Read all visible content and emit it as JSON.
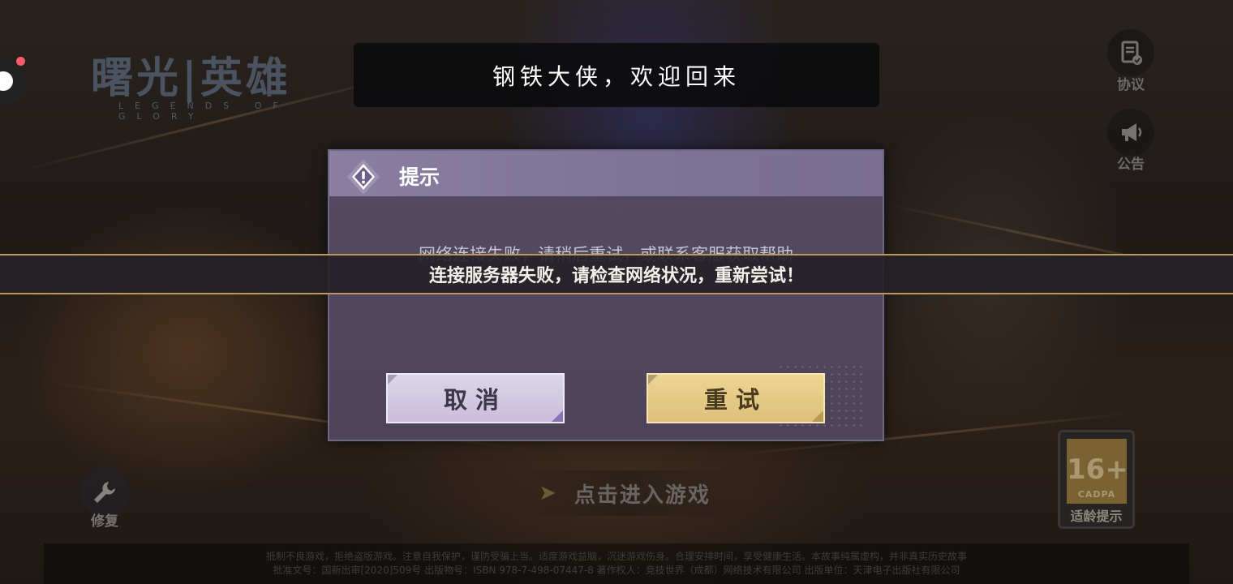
{
  "logo": {
    "title": "曙光|英雄",
    "subtitle": "LEGENDS OF GLORY"
  },
  "welcome": {
    "text": "钢铁大侠，欢迎回来"
  },
  "side": {
    "agreement_label": "协议",
    "notice_label": "公告"
  },
  "repair": {
    "label": "修复"
  },
  "enter_game": {
    "label": "点击进入游戏"
  },
  "age_rating": {
    "number": "16+",
    "org": "CADPA",
    "label": "适龄提示"
  },
  "footer": {
    "line1": "抵制不良游戏，拒绝盗版游戏。注意自我保护，谨防受骗上当。适度游戏益脑，沉迷游戏伤身。合理安排时间，享受健康生活。本故事纯属虚构，并非真实历史故事",
    "line2": "批准文号：国新出审[2020]509号  出版物号：ISBN 978-7-498-07447-8  著作权人：竞技世界（成都）网络技术有限公司  出版单位：天津电子出版社有限公司"
  },
  "dialog": {
    "title": "提示",
    "message": "网络连接失败，请稍后重试，或联系客服获取帮助",
    "cancel_label": "取消",
    "retry_label": "重试"
  },
  "toast": {
    "text": "连接服务器失败，请检查网络状况，重新尝试！"
  },
  "colors": {
    "accent_gold": "#ddc07a",
    "dialog_bg": "#544a63",
    "toast_border": "#b89a5a",
    "badge_red": "#ff5a6a"
  }
}
